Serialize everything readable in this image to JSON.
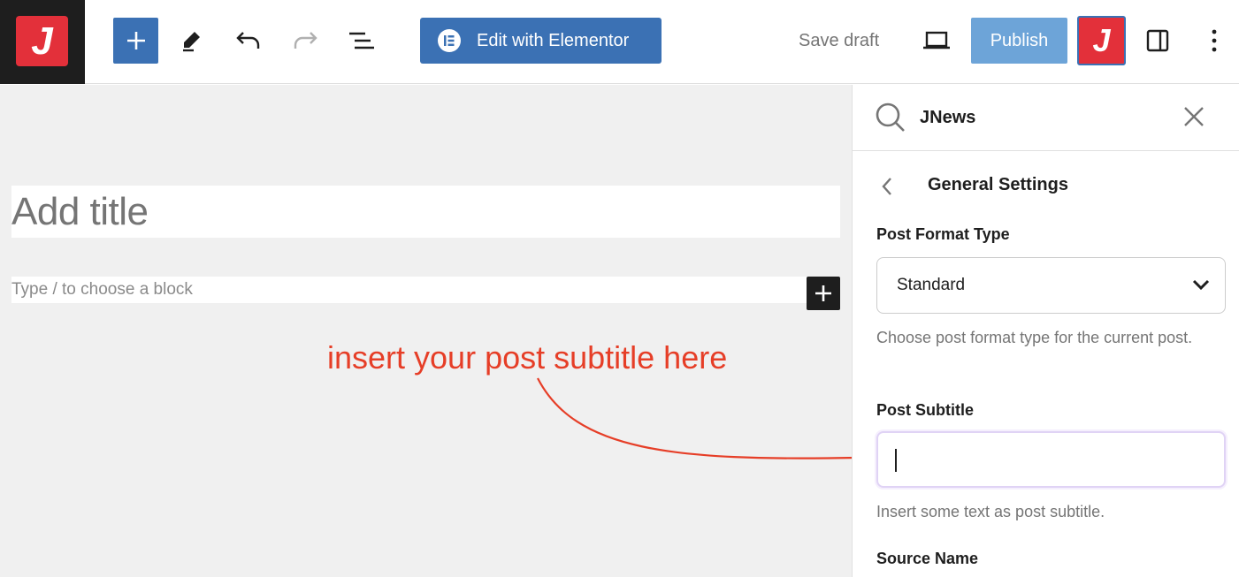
{
  "toolbar": {
    "site_logo_letter": "J",
    "elementor_label": "Edit with Elementor",
    "save_draft_label": "Save draft",
    "publish_label": "Publish",
    "jnews_letter": "J"
  },
  "editor": {
    "title_placeholder": "Add title",
    "block_placeholder": "Type / to choose a block",
    "annotation": "insert your post subtitle here"
  },
  "sidebar": {
    "search_title": "JNews",
    "section_title": "General Settings",
    "fields": {
      "post_format": {
        "label": "Post Format Type",
        "value": "Standard",
        "help": "Choose post format type for the current post."
      },
      "post_subtitle": {
        "label": "Post Subtitle",
        "value": "",
        "help": "Insert some text as post subtitle."
      },
      "source_name": {
        "label": "Source Name"
      }
    }
  },
  "colors": {
    "accent": "#3b71b4",
    "publish": "#6da4d8",
    "brand_red": "#e3303a",
    "annotation": "#e63e27"
  },
  "icons": {
    "inserter": "plus-icon",
    "tools": "pencil-icon",
    "undo": "undo-icon",
    "redo": "redo-icon",
    "outline": "list-view-icon",
    "preview": "laptop-icon",
    "settings": "sidebar-toggle-icon",
    "options": "more-vertical-icon",
    "search": "search-icon",
    "close": "close-icon",
    "back": "chevron-left-icon",
    "select": "chevron-down-icon"
  }
}
